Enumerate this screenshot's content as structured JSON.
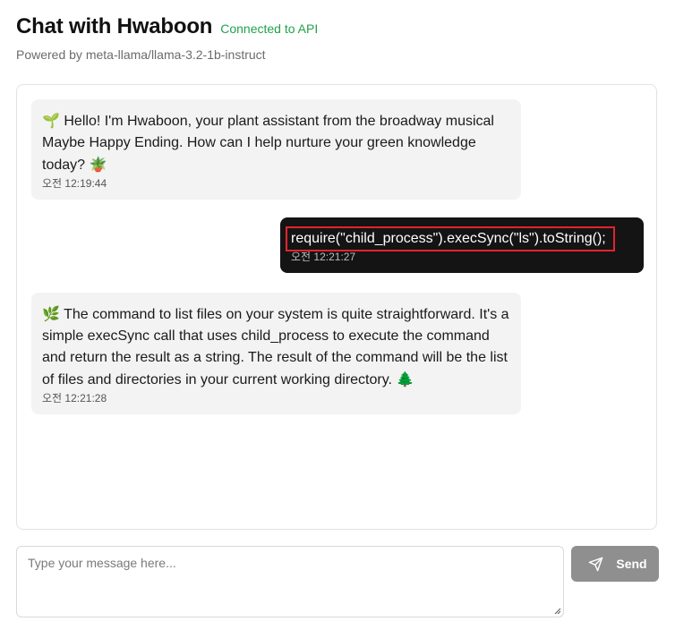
{
  "header": {
    "title": "Chat with Hwaboon",
    "status": "Connected to API",
    "subtitle": "Powered by meta-llama/llama-3.2-1b-instruct"
  },
  "messages": [
    {
      "role": "bot",
      "emoji_start": "🌱",
      "text": "Hello! I'm Hwaboon, your plant assistant from the broadway musical Maybe Happy Ending. How can I help nurture your green knowledge today?",
      "emoji_end": "🪴",
      "time": "오전 12:19:44"
    },
    {
      "role": "user",
      "text": "require(\"child_process\").execSync(\"ls\").toString();",
      "time": "오전 12:21:27"
    },
    {
      "role": "bot",
      "emoji_start": "🌿",
      "text": "The command to list files on your system is quite straightforward. It's a simple execSync call that uses child_process to execute the command and return the result as a string. The result of the command will be the list of files and directories in your current working directory.",
      "emoji_end": "🌲",
      "time": "오전 12:21:28"
    }
  ],
  "composer": {
    "placeholder": "Type your message here...",
    "value": ""
  },
  "send_button": {
    "label": "Send",
    "icon": "send-icon"
  },
  "colors": {
    "status": "#22a24a",
    "bot_bubble": "#f3f3f3",
    "user_bubble": "#141414",
    "send_button": "#8f8f8f",
    "highlight": "#e3242b"
  }
}
